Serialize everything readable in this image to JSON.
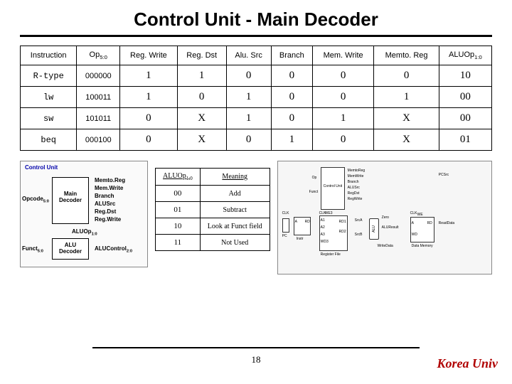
{
  "title": "Control Unit - Main Decoder",
  "main_table": {
    "headers": [
      "Instruction",
      "Op<sub>5:0</sub>",
      "Reg. Write",
      "Reg. Dst",
      "Alu. Src",
      "Branch",
      "Mem. Write",
      "Memto. Reg",
      "ALUOp<sub>1:0</sub>"
    ],
    "rows": [
      {
        "instr": "R-type",
        "op": "000000",
        "vals": [
          "1",
          "1",
          "0",
          "0",
          "0",
          "0",
          "10"
        ]
      },
      {
        "instr": "lw",
        "op": "100011",
        "vals": [
          "1",
          "0",
          "1",
          "0",
          "0",
          "1",
          "00"
        ]
      },
      {
        "instr": "sw",
        "op": "101011",
        "vals": [
          "0",
          "X",
          "1",
          "0",
          "1",
          "X",
          "00"
        ]
      },
      {
        "instr": "beq",
        "op": "000100",
        "vals": [
          "0",
          "X",
          "0",
          "1",
          "0",
          "X",
          "01"
        ]
      }
    ]
  },
  "cu_diagram": {
    "title": "Control Unit",
    "inputs": [
      "Opcode<sub>5:0</sub>",
      "Funct<sub>5:0</sub>"
    ],
    "main_dec": {
      "label": "Main Decoder",
      "outputs": [
        "Memto.Reg",
        "Mem.Write",
        "Branch",
        "ALUSrc",
        "Reg.Dst",
        "Reg.Write"
      ]
    },
    "mid_signal": "ALUOp<sub>1:0</sub>",
    "alu_dec": {
      "label": "ALU Decoder",
      "output": "ALUControl<sub>2:0</sub>"
    }
  },
  "aluop_table": {
    "headers": [
      "ALUOp<sub>1:0</sub>",
      "Meaning"
    ],
    "rows": [
      [
        "00",
        "Add"
      ],
      [
        "01",
        "Subtract"
      ],
      [
        "10",
        "Look at Funct field"
      ],
      [
        "11",
        "Not Used"
      ]
    ]
  },
  "dp_labels": [
    "MemtoReg",
    "MemWrite",
    "Branch",
    "ALUSrc",
    "RegDst",
    "RegWrite",
    "Op",
    "Funct",
    "Control Unit",
    "CLK",
    "PC",
    "A",
    "RD",
    "Instr",
    "WE3",
    "A1",
    "A2",
    "A3",
    "WD3",
    "RD1",
    "RD2",
    "Register File",
    "SrcA",
    "SrcB",
    "Zero",
    "ALUResult",
    "ALU",
    "WE",
    "A",
    "RD",
    "WD",
    "Data Memory",
    "ReadData",
    "PCSrc",
    "WriteData"
  ],
  "page_number": "18",
  "brand": "Korea Univ"
}
